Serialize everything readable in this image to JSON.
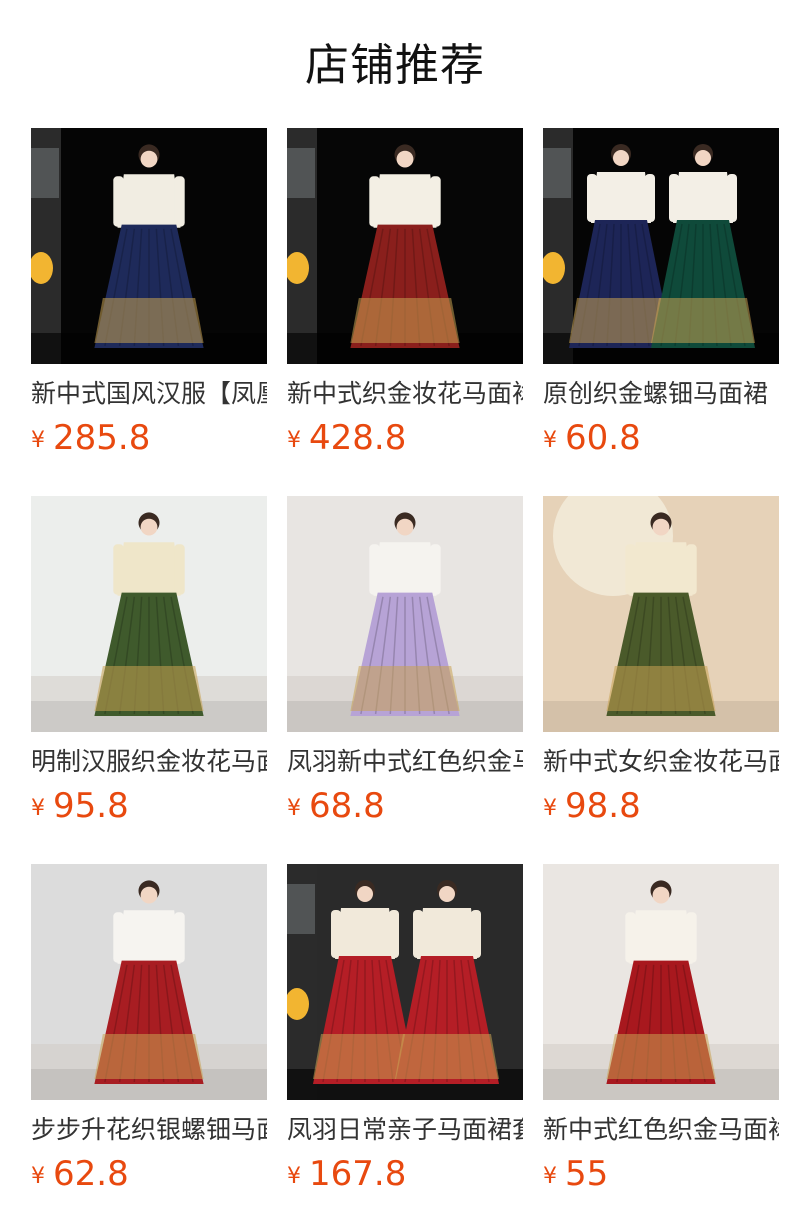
{
  "title": "店铺推荐",
  "currency_symbol": "¥",
  "products": [
    {
      "name": "新中式国风汉服【凤凰】织金马面裙",
      "price": "285.8",
      "scene": "dark",
      "skirt": "#1e2a5a",
      "skirt2": "#1e2a5a",
      "top": "#f1ede2",
      "bg": "#050505",
      "pair": false
    },
    {
      "name": "新中式织金妆花马面裙",
      "price": "428.8",
      "scene": "dark",
      "skirt": "#8a1f1c",
      "skirt2": "#8a1f1c",
      "top": "#f3efe4",
      "bg": "#060606",
      "pair": false
    },
    {
      "name": "原创织金螺钿马面裙",
      "price": "60.8",
      "scene": "dark",
      "skirt": "#1d2557",
      "skirt2": "#0f4a3a",
      "top": "#f3efe6",
      "bg": "#050505",
      "pair": true
    },
    {
      "name": "明制汉服织金妆花马面裙",
      "price": "95.8",
      "scene": "light",
      "skirt": "#3f5a2c",
      "skirt2": "#3f5a2c",
      "top": "#efe6c9",
      "bg": "#eceeec",
      "pair": false
    },
    {
      "name": "凤羽新中式红色织金马面裙",
      "price": "68.8",
      "scene": "light",
      "skirt": "#b7a3d6",
      "skirt2": "#b7a3d6",
      "top": "#f5f3ef",
      "bg": "#e8e5e2",
      "pair": false
    },
    {
      "name": "新中式女织金妆花马面裙",
      "price": "98.8",
      "scene": "warm",
      "skirt": "#4a5a2a",
      "skirt2": "#4a5a2a",
      "top": "#f2e8cf",
      "bg": "#e6d2b8",
      "pair": false
    },
    {
      "name": "步步升花织银螺钿马面裙",
      "price": "62.8",
      "scene": "light",
      "skirt": "#a81d22",
      "skirt2": "#a81d22",
      "top": "#f6f4f0",
      "bg": "#dcdcdc",
      "pair": false
    },
    {
      "name": "凤羽日常亲子马面裙套装",
      "price": "167.8",
      "scene": "dark",
      "skirt": "#b51e26",
      "skirt2": "#b51e26",
      "top": "#f1e9da",
      "bg": "#2a2a2a",
      "pair": true
    },
    {
      "name": "新中式红色织金马面裙",
      "price": "55",
      "scene": "light",
      "skirt": "#a8181e",
      "skirt2": "#a8181e",
      "top": "#f6f2ea",
      "bg": "#eae6e2",
      "pair": false
    }
  ]
}
